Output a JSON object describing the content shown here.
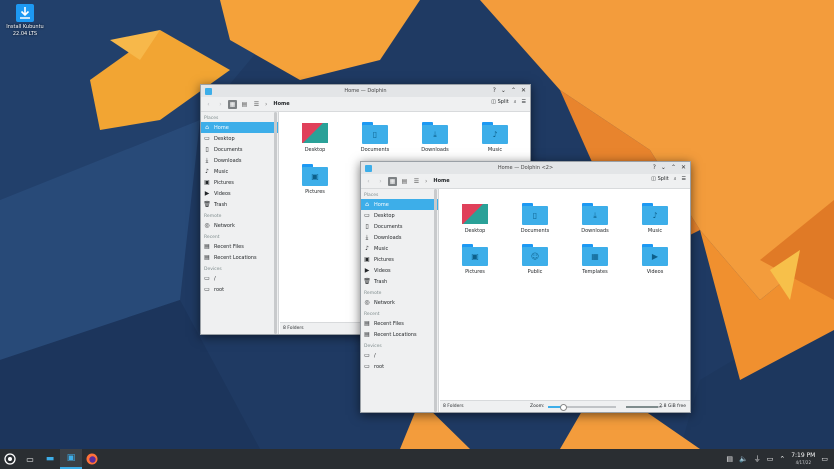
{
  "desktop": {
    "icon_label_line1": "Install Kubuntu",
    "icon_label_line2": "22.04 LTS"
  },
  "window_back": {
    "title": "Home — Dolphin",
    "breadcrumb": "Home",
    "split_label": "Split",
    "status": "8 Folders",
    "places_header": "Places",
    "places": [
      "Home",
      "Desktop",
      "Documents",
      "Downloads",
      "Music",
      "Pictures",
      "Videos",
      "Trash"
    ],
    "remote_header": "Remote",
    "remote": [
      "Network"
    ],
    "recent_header": "Recent",
    "recent": [
      "Recent Files",
      "Recent Locations"
    ],
    "devices_header": "Devices",
    "devices": [
      "/",
      "root"
    ],
    "items": [
      "Desktop",
      "Documents",
      "Downloads",
      "Music",
      "Pictures"
    ]
  },
  "window_front": {
    "title": "Home — Dolphin <2>",
    "breadcrumb": "Home",
    "split_label": "Split",
    "status": "8 Folders",
    "zoom_label": "Zoom:",
    "free_space": "2.8 GiB free",
    "places_header": "Places",
    "places": [
      "Home",
      "Desktop",
      "Documents",
      "Downloads",
      "Music",
      "Pictures",
      "Videos",
      "Trash"
    ],
    "remote_header": "Remote",
    "remote": [
      "Network"
    ],
    "recent_header": "Recent",
    "recent": [
      "Recent Files",
      "Recent Locations"
    ],
    "devices_header": "Devices",
    "devices": [
      "/",
      "root"
    ],
    "items": [
      "Desktop",
      "Documents",
      "Downloads",
      "Music",
      "Pictures",
      "Public",
      "Templates",
      "Videos"
    ]
  },
  "taskbar": {
    "time": "7:19 PM",
    "date": "4/17/22"
  },
  "colors": {
    "accent": "#3daee9",
    "folder": "#3daee9",
    "panel": "#2a2e32"
  }
}
